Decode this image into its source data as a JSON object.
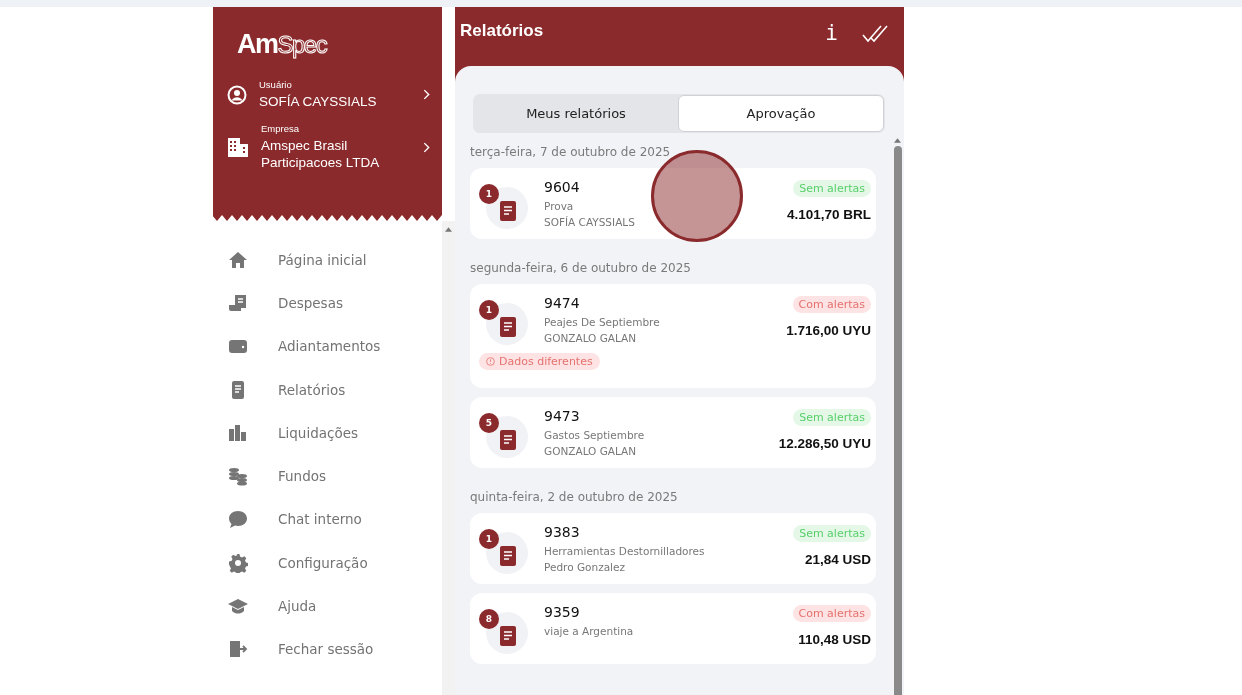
{
  "sidebar": {
    "logo_parts": [
      "Am",
      "Spec"
    ],
    "user": {
      "label": "Usuário",
      "value": "SOFÍA CAYSSIALS"
    },
    "company": {
      "label": "Empresa",
      "value": "Amspec Brasil Participacoes LTDA"
    },
    "items": [
      {
        "label": "Página inicial"
      },
      {
        "label": "Despesas"
      },
      {
        "label": "Adiantamentos"
      },
      {
        "label": "Relatórios"
      },
      {
        "label": "Liquidações"
      },
      {
        "label": "Fundos"
      },
      {
        "label": "Chat interno"
      },
      {
        "label": "Configuração"
      },
      {
        "label": "Ajuda"
      },
      {
        "label": "Fechar sessão"
      }
    ]
  },
  "header": {
    "title": "Relatórios",
    "info_glyph": "i"
  },
  "tabs": [
    {
      "label": "Meus relatórios",
      "selected": false
    },
    {
      "label": "Aprovação",
      "selected": true
    }
  ],
  "groups": [
    {
      "date": "terça-feira, 7 de outubro de 2025",
      "reports": [
        {
          "count": "1",
          "number": "9604",
          "title": "Prova",
          "person": "SOFÍA CAYSSIALS",
          "status": {
            "kind": "ok",
            "label": "Sem alertas"
          },
          "amount": "4.101,70 BRL"
        }
      ]
    },
    {
      "date": "segunda-feira, 6 de outubro de 2025",
      "reports": [
        {
          "count": "1",
          "number": "9474",
          "title": "Peajes De Septiembre",
          "person": "GONZALO GALAN",
          "status": {
            "kind": "alert",
            "label": "Com alertas"
          },
          "amount": "1.716,00 UYU",
          "warning": "Dados diferentes"
        },
        {
          "count": "5",
          "number": "9473",
          "title": "Gastos Septiembre",
          "person": "GONZALO GALAN",
          "status": {
            "kind": "ok",
            "label": "Sem alertas"
          },
          "amount": "12.286,50 UYU"
        }
      ]
    },
    {
      "date": "quinta-feira, 2 de outubro de 2025",
      "reports": [
        {
          "count": "1",
          "number": "9383",
          "title": "Herramientas Destornilladores",
          "person": "Pedro Gonzalez",
          "status": {
            "kind": "ok",
            "label": "Sem alertas"
          },
          "amount": "21,84 USD"
        },
        {
          "count": "8",
          "number": "9359",
          "title": "viaje a Argentina",
          "status": {
            "kind": "alert",
            "label": "Com alertas"
          },
          "amount": "110,48 USD"
        }
      ]
    }
  ]
}
